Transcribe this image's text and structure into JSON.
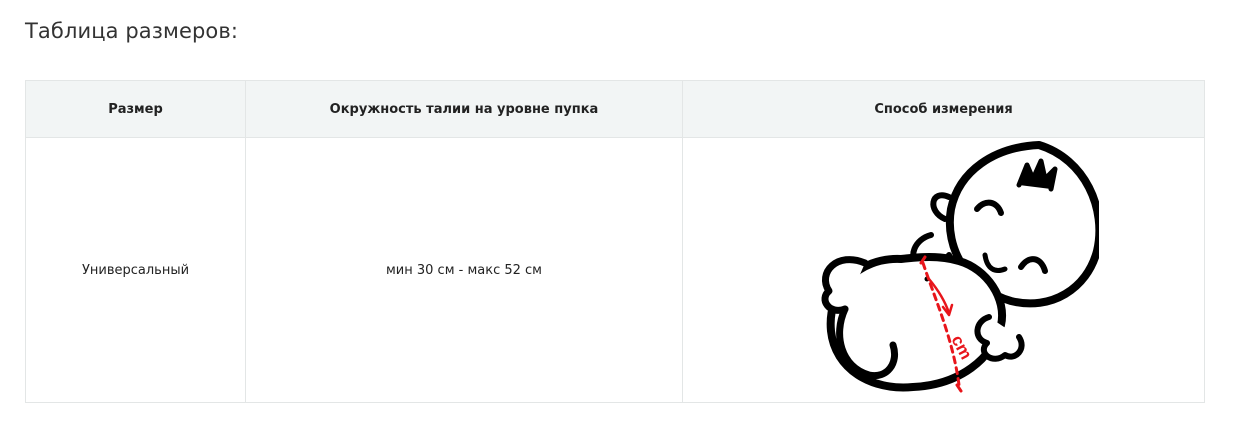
{
  "title": "Таблица размеров:",
  "table": {
    "headers": [
      "Размер",
      "Окружность талии на уровне пупка",
      "Способ измерения"
    ],
    "rows": [
      {
        "size": "Универсальный",
        "waist": "мин 30 см - макс 52 см"
      }
    ]
  },
  "illustration": {
    "measure_label": "cm",
    "measure_color": "#e8151b"
  }
}
